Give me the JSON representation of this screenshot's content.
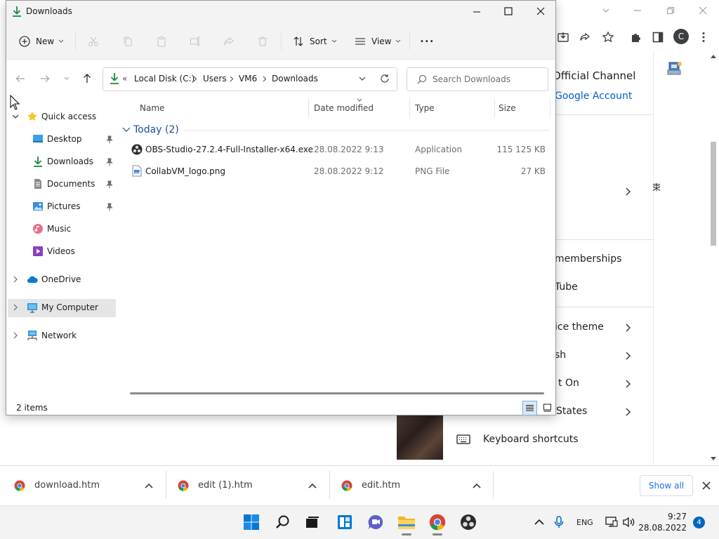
{
  "chrome": {
    "menu_items": [
      {
        "label": "Official Channel"
      },
      {
        "label": "Google Account"
      },
      {
        "label": "memberships"
      },
      {
        "label": "Tube"
      },
      {
        "label": "ice theme"
      },
      {
        "label": "sh"
      },
      {
        "label": "t On"
      },
      {
        "label": "States"
      },
      {
        "label": "Keyboard shortcuts"
      }
    ],
    "profile_initial": "C",
    "side_glyph": "束"
  },
  "download_bar": {
    "items": [
      {
        "name": "download.htm"
      },
      {
        "name": "edit (1).htm"
      },
      {
        "name": "edit.htm"
      }
    ],
    "show_all": "Show all"
  },
  "taskbar": {
    "language": "ENG",
    "time": "9:27",
    "date": "28.08.2022",
    "notification_count": "4"
  },
  "explorer": {
    "title": "Downloads",
    "commands": {
      "new": "New",
      "sort": "Sort",
      "view": "View",
      "more": "•••"
    },
    "address": {
      "prefix": "«",
      "crumbs": [
        "Local Disk (C:)",
        "Users",
        "VM6",
        "Downloads"
      ]
    },
    "search_placeholder": "Search Downloads",
    "nav": {
      "quick_access": "Quick access",
      "quick_items": [
        {
          "label": "Desktop",
          "pinned": true
        },
        {
          "label": "Downloads",
          "pinned": true
        },
        {
          "label": "Documents",
          "pinned": true
        },
        {
          "label": "Pictures",
          "pinned": true
        },
        {
          "label": "Music",
          "pinned": false
        },
        {
          "label": "Videos",
          "pinned": false
        }
      ],
      "onedrive": "OneDrive",
      "my_computer": "My Computer",
      "network": "Network"
    },
    "columns": {
      "name": "Name",
      "date": "Date modified",
      "type": "Type",
      "size": "Size"
    },
    "group": "Today (2)",
    "files": [
      {
        "name": "OBS-Studio-27.2.4-Full-Installer-x64.exe",
        "date": "28.08.2022 9:13",
        "type": "Application",
        "size": "115 125 KB",
        "icon": "obs-icon"
      },
      {
        "name": "CollabVM_logo.png",
        "date": "28.08.2022 9:12",
        "type": "PNG File",
        "size": "27 KB",
        "icon": "png-file-icon"
      }
    ],
    "status": "2 items"
  },
  "colors": {
    "accent": "#0067c0",
    "group_header": "#1f4e96",
    "download_green": "#1b8a3f"
  }
}
